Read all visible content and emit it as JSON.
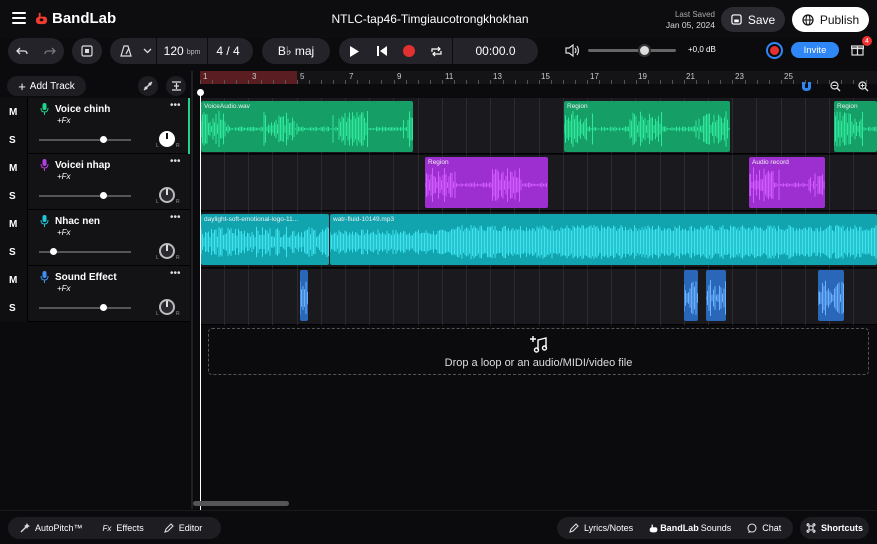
{
  "header": {
    "brand": "BandLab",
    "project_title": "NTLC-tap46-Timgiaucotrongkhokhan",
    "last_saved_label": "Last Saved",
    "last_saved_date": "Jan 05, 2024",
    "save_label": "Save",
    "publish_label": "Publish"
  },
  "toolbar": {
    "tempo": "120",
    "tempo_unit": "bpm",
    "time_signature": "4 / 4",
    "key": "B♭ maj",
    "time_display": "00:00.0",
    "master_volume_db": "+0,0 dB",
    "master_volume_level": 0.6,
    "invite_label": "Invite",
    "notification_count": "4"
  },
  "tracks_panel": {
    "add_track_label": "Add Track"
  },
  "tracks": [
    {
      "name": "Voice chinh",
      "fx": "+Fx",
      "mute": "M",
      "solo": "S",
      "volume": 0.72,
      "color": "#1fd38c",
      "selected": true
    },
    {
      "name": "Voicei nhap",
      "fx": "+Fx",
      "mute": "M",
      "solo": "S",
      "volume": 0.72,
      "color": "#b23fe0",
      "selected": false
    },
    {
      "name": "Nhac nen",
      "fx": "+Fx",
      "mute": "M",
      "solo": "S",
      "volume": 0.15,
      "color": "#1ec7d6",
      "selected": false
    },
    {
      "name": "Sound Effect",
      "fx": "+Fx",
      "mute": "M",
      "solo": "S",
      "volume": 0.72,
      "color": "#3d8ef0",
      "selected": false
    }
  ],
  "ruler": {
    "bars": [
      "1",
      "3",
      "5",
      "7",
      "9",
      "11",
      "13",
      "15",
      "17",
      "19",
      "21",
      "23",
      "25"
    ]
  },
  "regions": {
    "voice_main": [
      "VoiceAudio.wav",
      "Region",
      "Region"
    ],
    "voice_draft": [
      "Region",
      "Audio record"
    ],
    "background": [
      "daylight-soft-emotional-logo-11...",
      "watr-fluid-10149.mp3"
    ]
  },
  "drop_zone": {
    "text": "Drop a loop or an audio/MIDI/video file"
  },
  "footer": {
    "autopitch": "AutoPitch™",
    "effects_prefix": "Fx",
    "effects": "Effects",
    "editor": "Editor",
    "lyrics": "Lyrics/Notes",
    "sounds_brand": "BandLab",
    "sounds": "Sounds",
    "chat": "Chat",
    "shortcuts": "Shortcuts"
  },
  "colors": {
    "accent_blue": "#2f86f6",
    "record_red": "#e33030",
    "green_track": "#1fd38c",
    "purple_track": "#b23fe0",
    "cyan_track": "#1ec7d6",
    "blue_track": "#3d8ef0"
  }
}
